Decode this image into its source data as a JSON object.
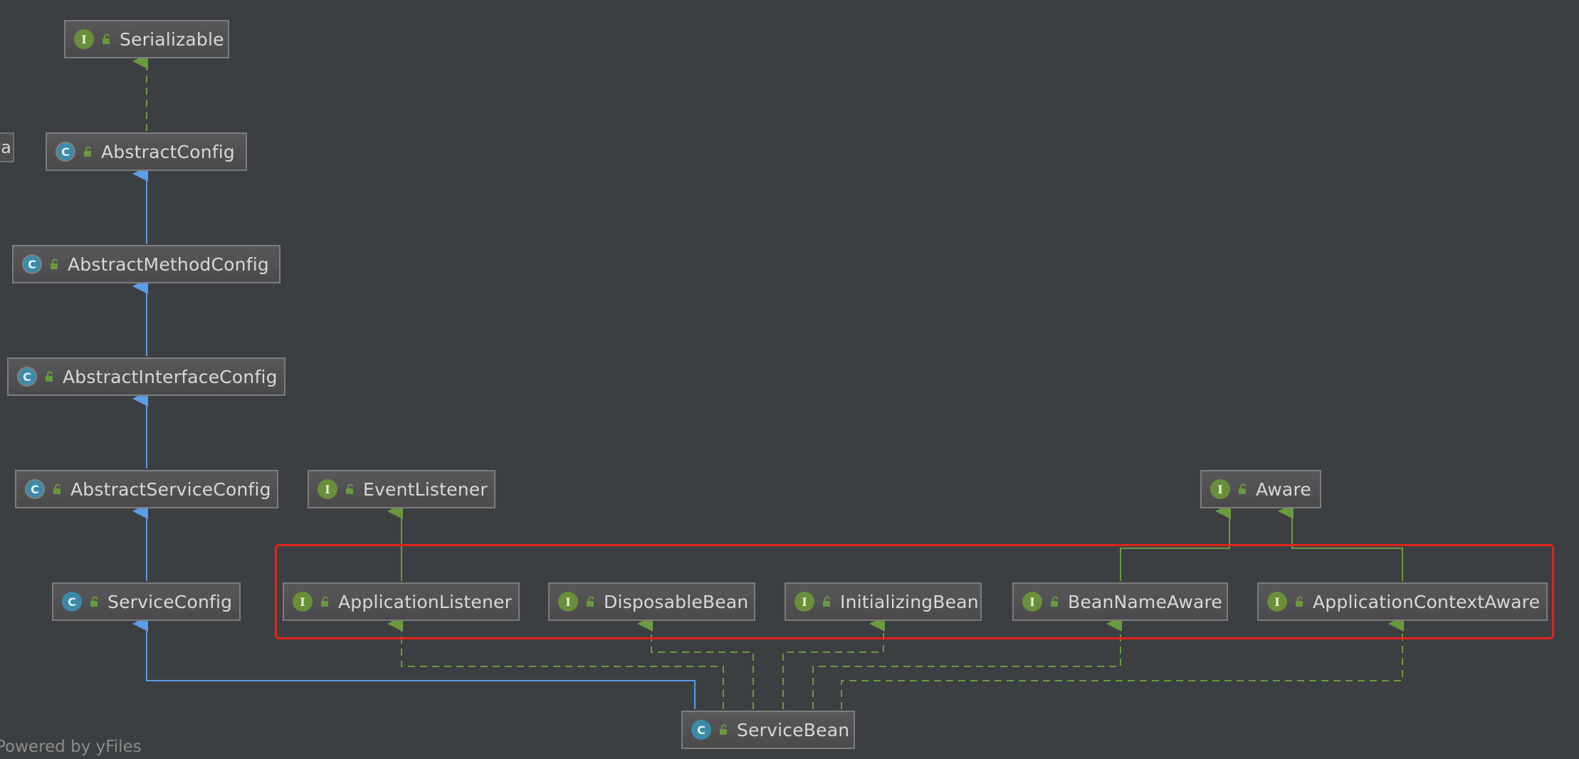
{
  "nodes": [
    {
      "id": "serializable",
      "kind": "I",
      "label": "Serializable"
    },
    {
      "id": "abstract_config",
      "kind": "A",
      "label": "AbstractConfig"
    },
    {
      "id": "abstract_method_config",
      "kind": "A",
      "label": "AbstractMethodConfig"
    },
    {
      "id": "abstract_interface_config",
      "kind": "A",
      "label": "AbstractInterfaceConfig"
    },
    {
      "id": "abstract_service_config",
      "kind": "A",
      "label": "AbstractServiceConfig"
    },
    {
      "id": "service_config",
      "kind": "C",
      "label": "ServiceConfig"
    },
    {
      "id": "event_listener",
      "kind": "I",
      "label": "EventListener"
    },
    {
      "id": "aware",
      "kind": "I",
      "label": "Aware"
    },
    {
      "id": "application_listener",
      "kind": "I",
      "label": "ApplicationListener"
    },
    {
      "id": "disposable_bean",
      "kind": "I",
      "label": "DisposableBean"
    },
    {
      "id": "initializing_bean",
      "kind": "I",
      "label": "InitializingBean"
    },
    {
      "id": "bean_name_aware",
      "kind": "I",
      "label": "BeanNameAware"
    },
    {
      "id": "application_context_aware",
      "kind": "I",
      "label": "ApplicationContextAware"
    },
    {
      "id": "service_bean",
      "kind": "C",
      "label": "ServiceBean"
    }
  ],
  "badge_letters": {
    "I": "I",
    "C": "C",
    "A": "C"
  },
  "edges": [
    {
      "from": "abstract_config",
      "to": "serializable",
      "type": "implements"
    },
    {
      "from": "abstract_method_config",
      "to": "abstract_config",
      "type": "extends"
    },
    {
      "from": "abstract_interface_config",
      "to": "abstract_method_config",
      "type": "extends"
    },
    {
      "from": "abstract_service_config",
      "to": "abstract_interface_config",
      "type": "extends"
    },
    {
      "from": "service_config",
      "to": "abstract_service_config",
      "type": "extends"
    },
    {
      "from": "service_bean",
      "to": "service_config",
      "type": "extends"
    },
    {
      "from": "application_listener",
      "to": "event_listener",
      "type": "interface-extends"
    },
    {
      "from": "bean_name_aware",
      "to": "aware",
      "type": "interface-extends"
    },
    {
      "from": "application_context_aware",
      "to": "aware",
      "type": "interface-extends"
    },
    {
      "from": "service_bean",
      "to": "application_listener",
      "type": "implements"
    },
    {
      "from": "service_bean",
      "to": "disposable_bean",
      "type": "implements"
    },
    {
      "from": "service_bean",
      "to": "initializing_bean",
      "type": "implements"
    },
    {
      "from": "service_bean",
      "to": "bean_name_aware",
      "type": "implements"
    },
    {
      "from": "service_bean",
      "to": "application_context_aware",
      "type": "implements"
    }
  ],
  "colors": {
    "extends": "#5c9ce8",
    "implements": "#6a9a3e",
    "highlight": "#e0241d",
    "background": "#3c3f41"
  },
  "icons": {
    "visibility": "public-unlocked-lock-icon"
  },
  "edge_tab_text": "va",
  "footer": "Powered by yFiles"
}
